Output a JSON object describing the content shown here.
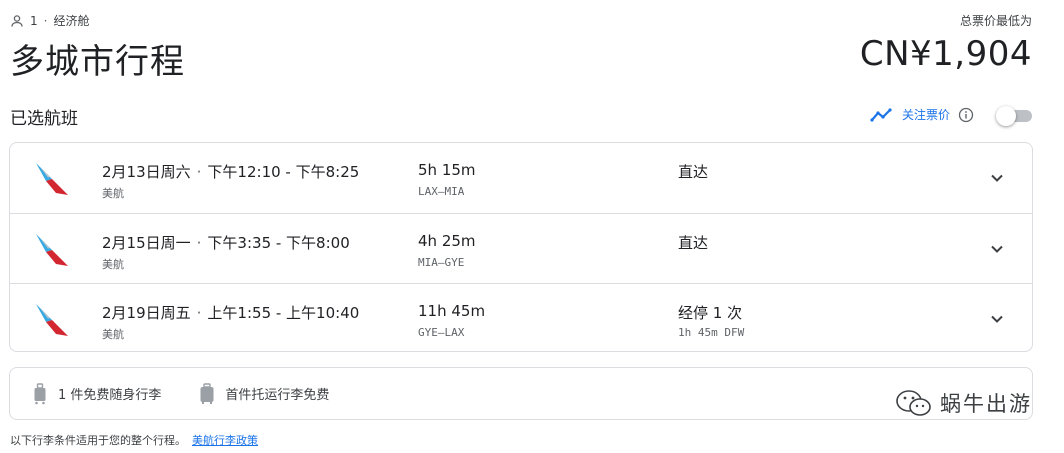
{
  "header": {
    "passengers": "1",
    "cabin": "经济舱",
    "title": "多城市行程",
    "price_label": "总票价最低为",
    "price": "CN¥1,904"
  },
  "section": {
    "title": "已选航班",
    "track_prices_label": "关注票价"
  },
  "flights": [
    {
      "date": "2月13日周六",
      "time": "下午12:10 - 下午8:25",
      "airline": "美航",
      "duration": "5h 15m",
      "route": "LAX–MIA",
      "stops": "直达",
      "stop_detail": ""
    },
    {
      "date": "2月15日周一",
      "time": "下午3:35 - 下午8:00",
      "airline": "美航",
      "duration": "4h 25m",
      "route": "MIA–GYE",
      "stops": "直达",
      "stop_detail": ""
    },
    {
      "date": "2月19日周五",
      "time": "上午1:55 - 上午10:40",
      "airline": "美航",
      "duration": "11h 45m",
      "route": "GYE–LAX",
      "stops": "经停 1 次",
      "stop_detail": "1h 45m DFW"
    }
  ],
  "baggage": {
    "carry_on": "1 件免费随身行李",
    "checked": "首件托运行李免费"
  },
  "footnote": {
    "text": "以下行李条件适用于您的整个行程。",
    "link": "美航行李政策"
  },
  "watermark": "蜗牛出游",
  "colors": {
    "accent": "#1a73e8",
    "border": "#dadce0",
    "aa_blue": "#36a9e1",
    "aa_red": "#d22630"
  }
}
